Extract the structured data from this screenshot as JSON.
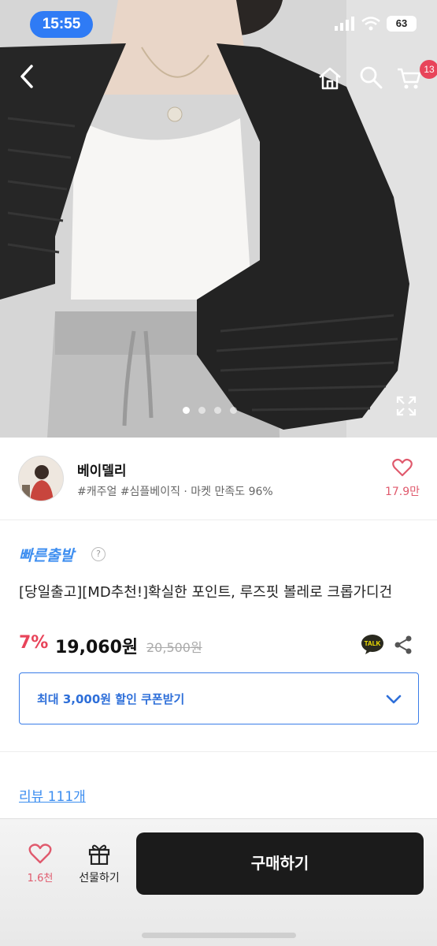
{
  "status_bar": {
    "time": "15:55",
    "battery": "63"
  },
  "header": {
    "cart_badge": "13"
  },
  "gallery": {
    "dot_count": 4,
    "active_index": 0
  },
  "store": {
    "name": "베이델리",
    "tags": "#캐주얼 #심플베이직 · 마켓 만족도 96%",
    "favorite_count": "17.9만"
  },
  "product": {
    "badge": "빠른출발",
    "help": "?",
    "title": "[당일출고][MD추천!]확실한 포인트, 루즈핏 볼레로 크롭가디건",
    "discount": "7%",
    "price": "19,060원",
    "original_price": "20,500원",
    "talk_label": "TALK",
    "coupon_label": "최대 3,000원 할인 쿠폰받기",
    "review_link": "리뷰 111개"
  },
  "bottom_bar": {
    "like_count": "1.6천",
    "gift_label": "선물하기",
    "buy_label": "구매하기"
  },
  "colors": {
    "accent_blue": "#3d8ef0",
    "discount_red": "#e8445a",
    "buy_button": "#1b1b1b"
  }
}
